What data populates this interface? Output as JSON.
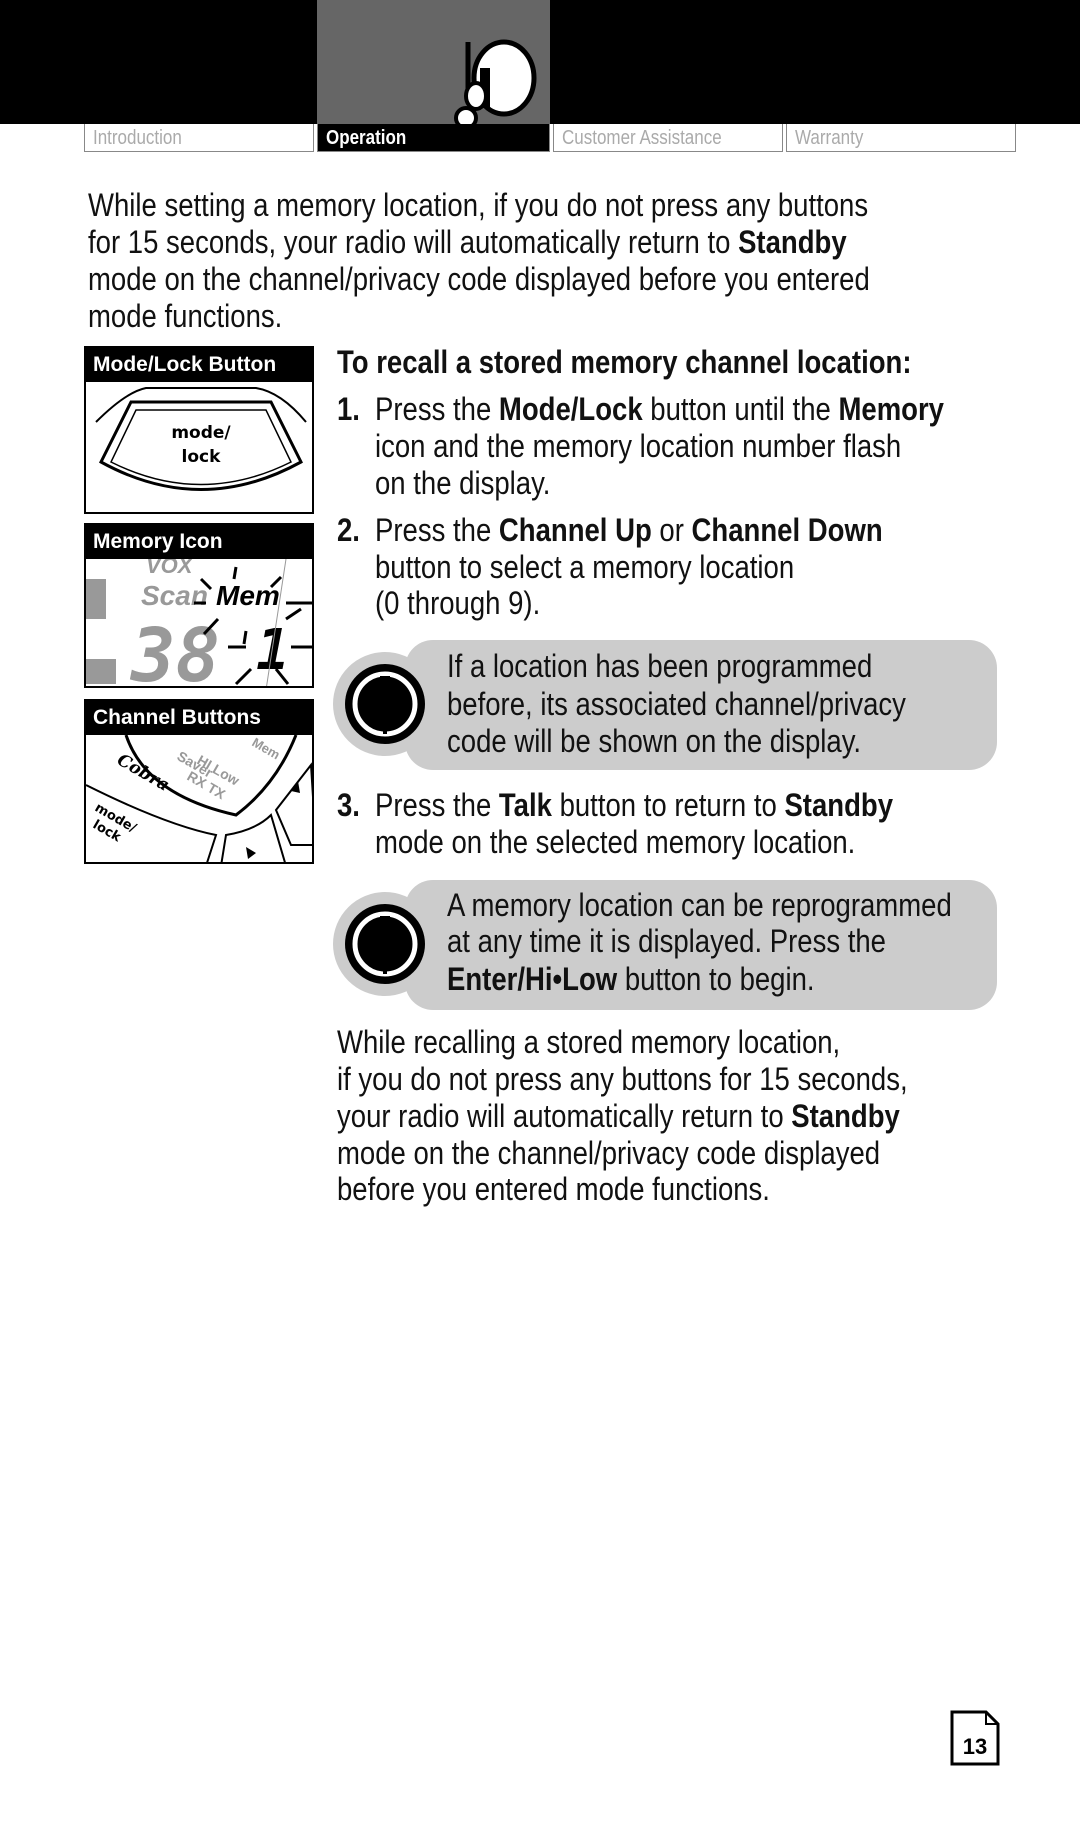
{
  "nav": {
    "tabs": [
      {
        "label": "Introduction",
        "active": false
      },
      {
        "label": "Operation",
        "active": true
      },
      {
        "label": "Customer Assistance",
        "active": false
      },
      {
        "label": "Warranty",
        "active": false
      }
    ],
    "section_icon": "radio-person-icon"
  },
  "intro": [
    [
      {
        "t": "While setting a memory location, if you do not press any buttons"
      }
    ],
    [
      {
        "t": "for 15 seconds, your radio will automatically return to "
      },
      {
        "t": "Standby",
        "b": true
      }
    ],
    [
      {
        "t": "mode on the channel/privacy code displayed before you entered"
      }
    ],
    [
      {
        "t": "mode functions."
      }
    ]
  ],
  "figures": [
    {
      "caption": "Mode/Lock Button",
      "button_text": [
        "mode/",
        "lock"
      ]
    },
    {
      "caption": "Memory Icon",
      "display": {
        "vox": "VOX",
        "scan": "Scan",
        "mem": "Mem",
        "channel": "38",
        "memory": "1"
      }
    },
    {
      "caption": "Channel Buttons",
      "brand": "Cobra",
      "button_text": [
        "mode/",
        "lock"
      ],
      "display_labels": [
        "Saver",
        "HI Low",
        "RX TX",
        "Mem"
      ]
    }
  ],
  "heading": "To recall a stored memory channel location:",
  "steps": [
    {
      "number": "1.",
      "lines": [
        [
          {
            "t": "Press the "
          },
          {
            "t": "Mode/Lock",
            "b": true
          },
          {
            "t": " button until the "
          },
          {
            "t": "Memory",
            "b": true
          }
        ],
        [
          {
            "t": "icon and the memory location number flash"
          }
        ],
        [
          {
            "t": "on the display."
          }
        ]
      ]
    },
    {
      "number": "2.",
      "lines": [
        [
          {
            "t": "Press the "
          },
          {
            "t": "Channel Up",
            "b": true
          },
          {
            "t": " or "
          },
          {
            "t": "Channel Down",
            "b": true
          }
        ],
        [
          {
            "t": "button to select a memory location"
          }
        ],
        [
          {
            "t": "(0 through 9)."
          }
        ]
      ]
    },
    {
      "number": "3.",
      "lines": [
        [
          {
            "t": "Press the "
          },
          {
            "t": "Talk",
            "b": true
          },
          {
            "t": " button to return to "
          },
          {
            "t": "Standby",
            "b": true
          }
        ],
        [
          {
            "t": "mode on the selected memory location."
          }
        ]
      ]
    }
  ],
  "notes": [
    {
      "icon": "note-icon",
      "lines": [
        [
          {
            "t": "If a location has been programmed"
          }
        ],
        [
          {
            "t": "before, its associated channel/privacy"
          }
        ],
        [
          {
            "t": "code will be shown on the display."
          }
        ]
      ]
    },
    {
      "icon": "note-icon",
      "lines": [
        [
          {
            "t": "A memory location can be reprogrammed"
          }
        ],
        [
          {
            "t": "at any time it is displayed. Press the"
          }
        ],
        [
          {
            "t": "Enter/Hi•Low",
            "b": true
          },
          {
            "t": " button to begin."
          }
        ]
      ]
    }
  ],
  "closing": [
    [
      {
        "t": "While recalling a stored memory location,"
      }
    ],
    [
      {
        "t": "if you do not press any buttons for 15 seconds,"
      }
    ],
    [
      {
        "t": "your radio will automatically return to "
      },
      {
        "t": "Standby",
        "b": true
      }
    ],
    [
      {
        "t": "mode on the channel/privacy code displayed"
      }
    ],
    [
      {
        "t": "before you entered mode functions."
      }
    ]
  ],
  "page_number": "13",
  "colors": {
    "header": "#000000",
    "active_section": "#666666",
    "note_bg": "#cccccc"
  }
}
